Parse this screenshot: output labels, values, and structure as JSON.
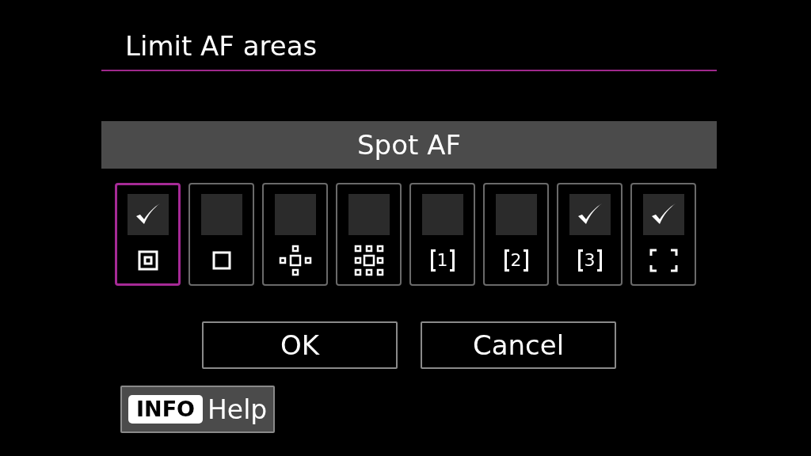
{
  "title": "Limit AF areas",
  "mode_label": "Spot AF",
  "af_modes": [
    {
      "kind": "spot",
      "selected": true,
      "checked": true
    },
    {
      "kind": "single",
      "selected": false,
      "checked": false
    },
    {
      "kind": "expand4",
      "selected": false,
      "checked": false
    },
    {
      "kind": "expand8",
      "selected": false,
      "checked": false
    },
    {
      "kind": "zone",
      "digit": "1",
      "selected": false,
      "checked": false
    },
    {
      "kind": "zone",
      "digit": "2",
      "selected": false,
      "checked": false
    },
    {
      "kind": "zone",
      "digit": "3",
      "selected": false,
      "checked": true
    },
    {
      "kind": "large-zone",
      "selected": false,
      "checked": true
    }
  ],
  "buttons": [
    "OK",
    "Cancel"
  ],
  "help": {
    "key": "INFO",
    "label": "Help"
  }
}
